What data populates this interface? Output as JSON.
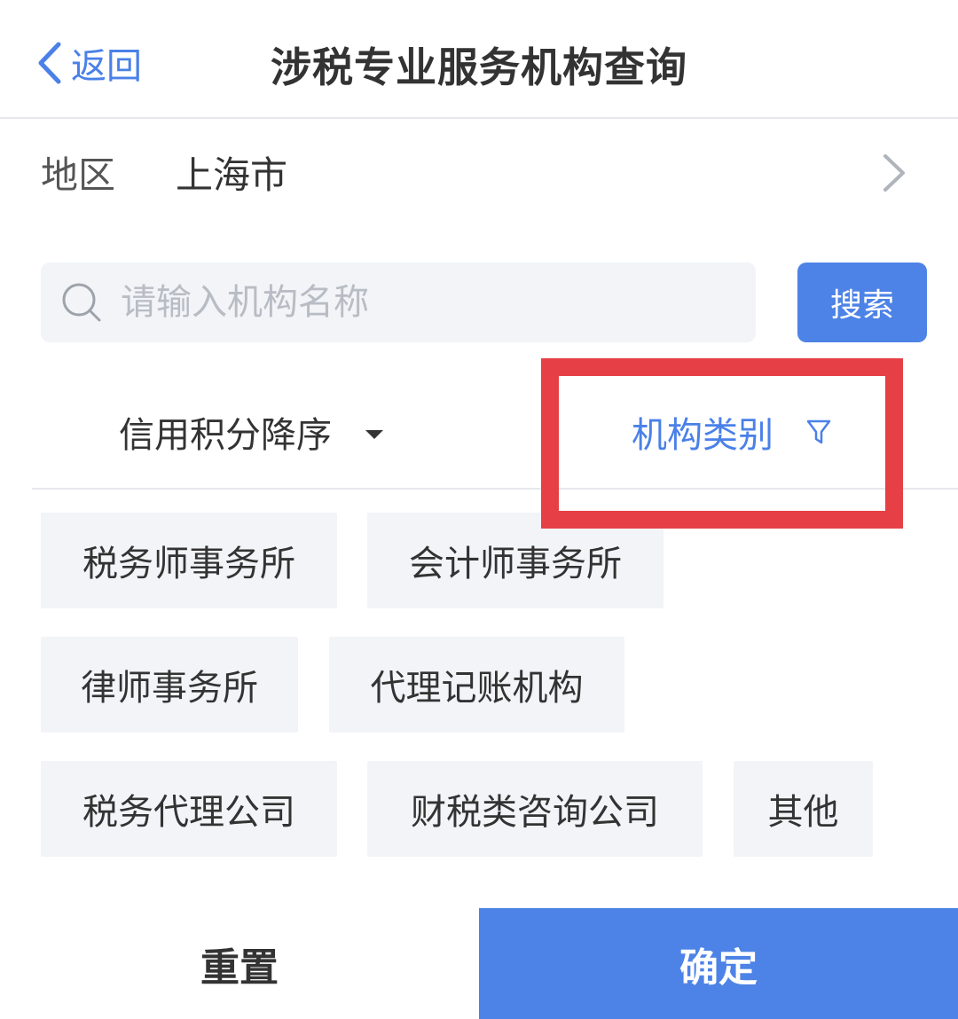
{
  "nav": {
    "back_label": "返回",
    "title": "涉税专业服务机构查询"
  },
  "region": {
    "label": "地区",
    "value": "上海市"
  },
  "search": {
    "placeholder": "请输入机构名称",
    "button_label": "搜索"
  },
  "filters": {
    "sort_label": "信用积分降序",
    "category_label": "机构类别"
  },
  "categories": [
    "税务师事务所",
    "会计师事务所",
    "律师事务所",
    "代理记账机构",
    "税务代理公司",
    "财税类咨询公司",
    "其他"
  ],
  "footer": {
    "reset_label": "重置",
    "confirm_label": "确定"
  },
  "colors": {
    "accent": "#4d83e6",
    "link": "#4a80e8",
    "highlight": "#e64046",
    "chip_bg": "#f2f4f7"
  },
  "icons": [
    "back-chevron-icon",
    "chevron-right-icon",
    "search-icon",
    "caret-down-icon",
    "filter-funnel-icon"
  ]
}
